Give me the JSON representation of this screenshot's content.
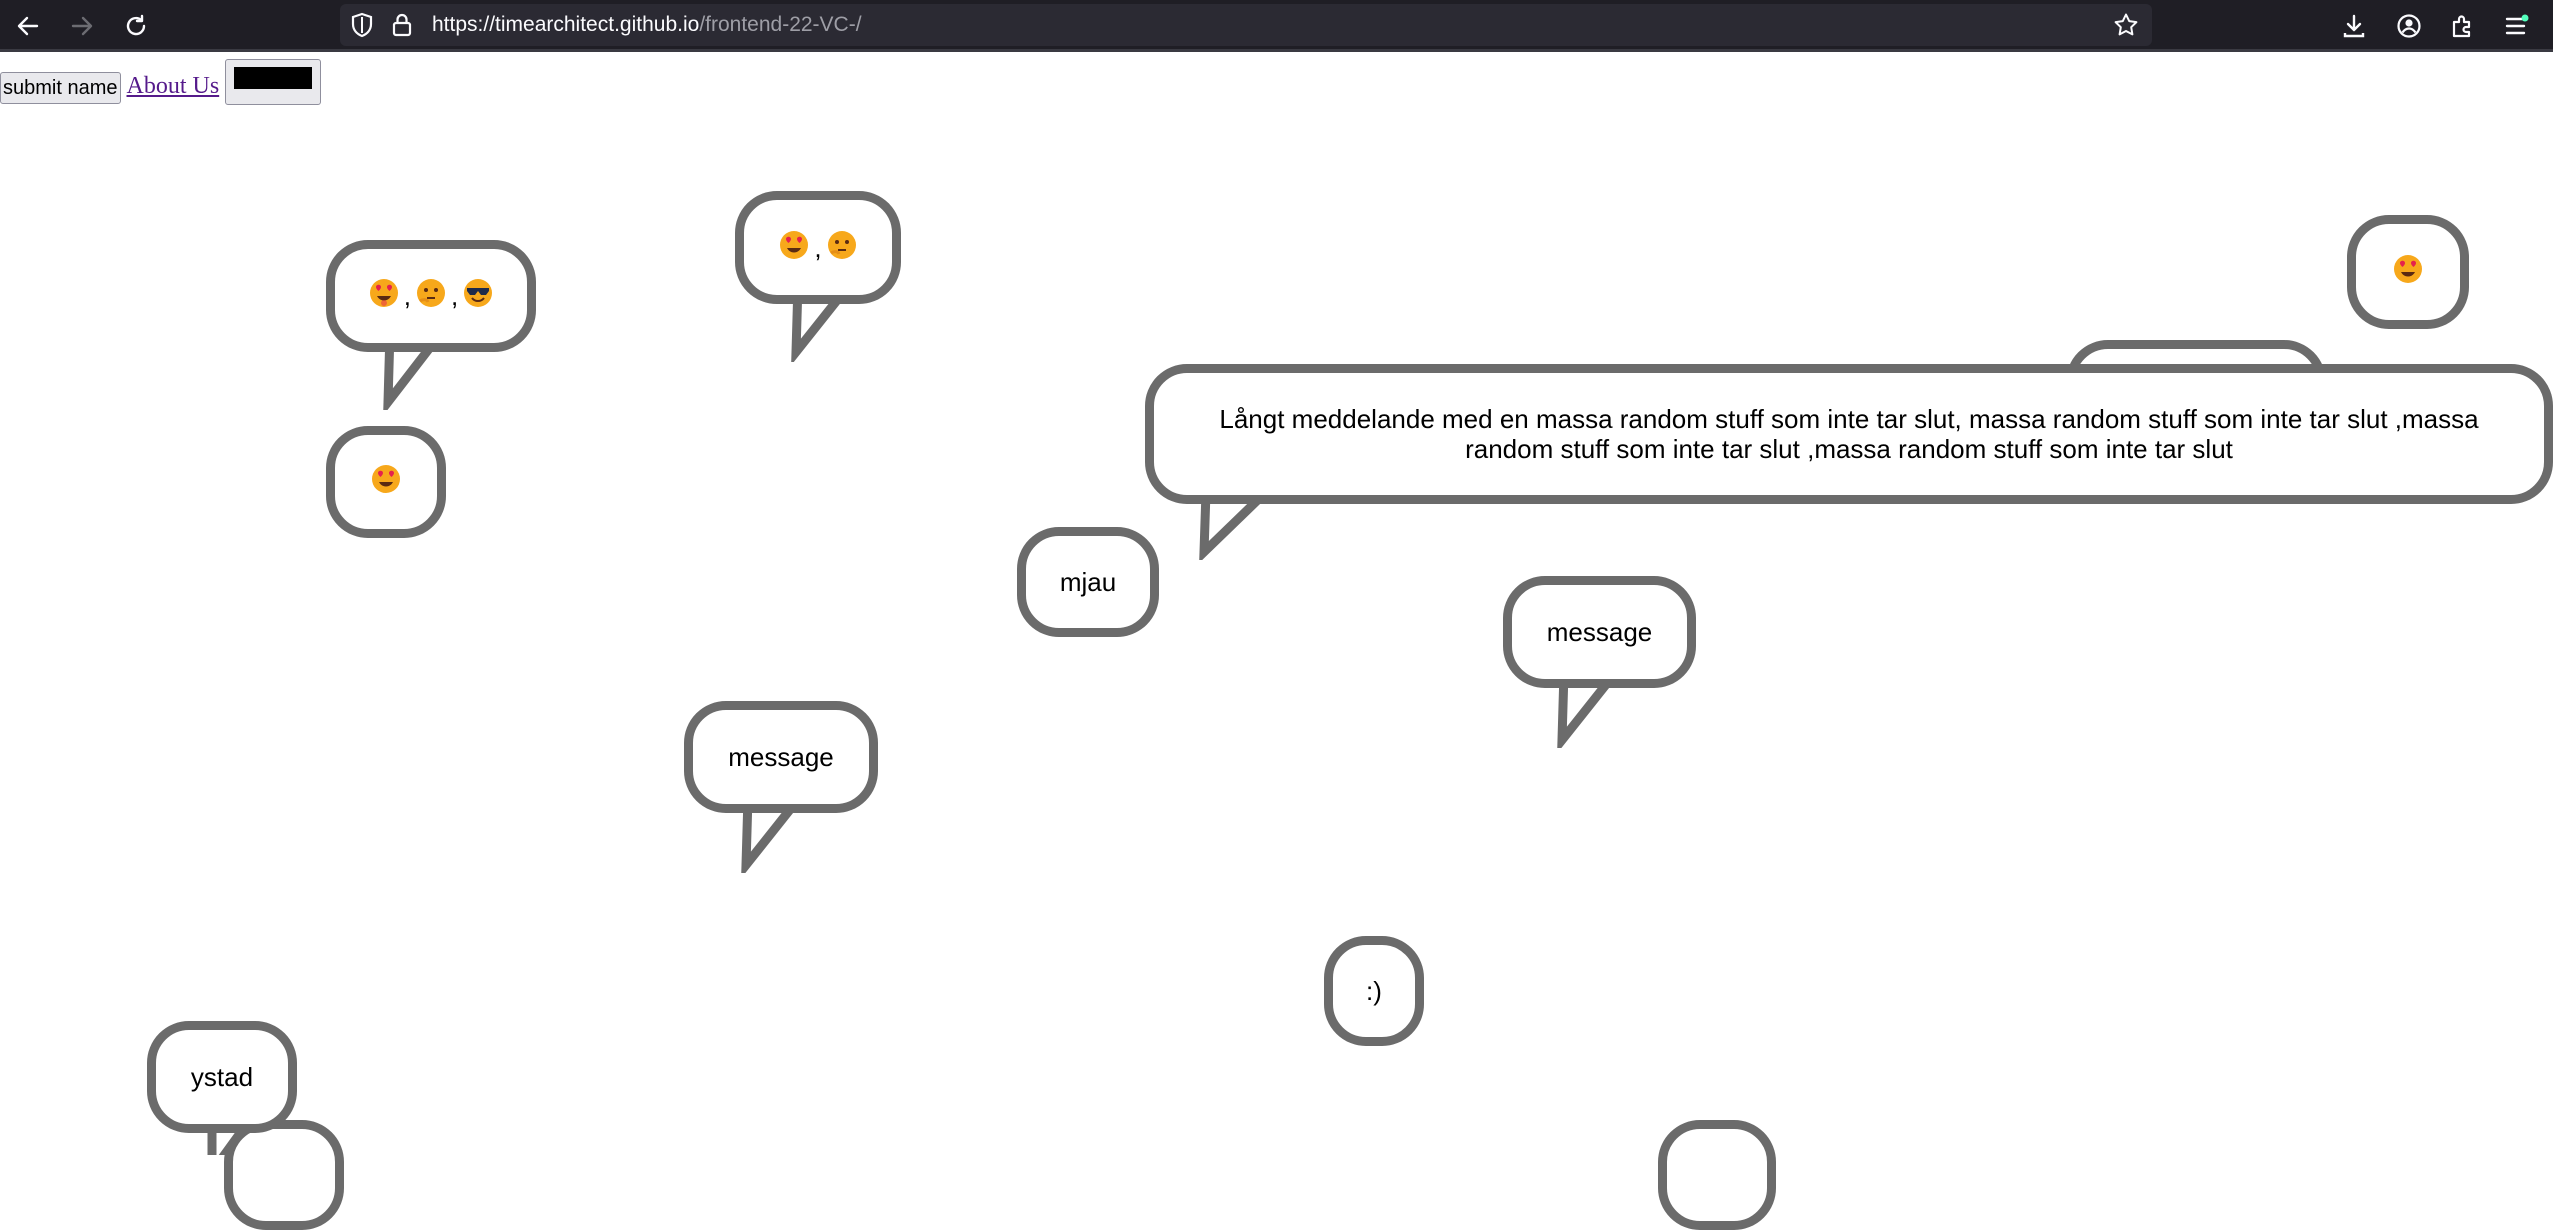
{
  "browser": {
    "url_host": "https://timearchitect.github.io",
    "url_path": "/frontend-22-VC-/"
  },
  "page": {
    "submit_label": "submit name",
    "about_label": "About Us",
    "color_value": "#000000"
  },
  "bubbles": {
    "emoji_triple_sep1": ",",
    "emoji_triple_sep2": ",",
    "emoji_double_sep": ",",
    "long_message": "Långt meddelande med en massa random stuff som inte tar slut, massa random stuff som inte tar slut ,massa random stuff som inte tar slut ,massa random stuff som inte tar slut",
    "mjau": "mjau",
    "message_right": "message",
    "message_left": "message",
    "smile": ":)",
    "ystad": "ystad"
  },
  "colors": {
    "bubble_border": "#6b6b6b",
    "link_visited": "#551a8b",
    "toolbar_bg": "#1f1e25"
  }
}
